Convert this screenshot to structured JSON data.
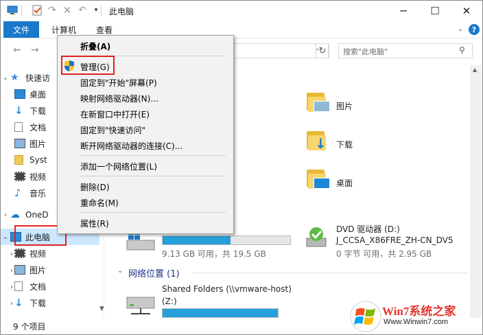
{
  "window": {
    "title": "此电脑",
    "controls": {
      "minimize": "─",
      "maximize": "☐",
      "close": "✕"
    }
  },
  "ribbon": {
    "file_tab": "文件",
    "tabs": [
      "计算机",
      "查看"
    ]
  },
  "search": {
    "placeholder": "搜索\"此电脑\""
  },
  "nav": {
    "quick_access": "快速访",
    "items": [
      {
        "label": "桌面"
      },
      {
        "label": "下载"
      },
      {
        "label": "文档"
      },
      {
        "label": "图片"
      },
      {
        "label": "Syst"
      },
      {
        "label": "视频"
      },
      {
        "label": "音乐"
      }
    ],
    "onedrive": "OneD",
    "this_pc": "此电脑",
    "pc_children": [
      {
        "label": "视频"
      },
      {
        "label": "图片"
      },
      {
        "label": "文档"
      },
      {
        "label": "下载"
      }
    ]
  },
  "content": {
    "folders": [
      {
        "label": "图片"
      },
      {
        "label": "下载"
      },
      {
        "label": "桌面"
      }
    ],
    "drive_c": {
      "free_text": "9.13 GB 可用，共 19.5 GB",
      "fill": 0.53
    },
    "dvd": {
      "name": "DVD 驱动器 (D:)",
      "volume": "J_CCSA_X86FRE_ZH-CN_DV5",
      "free_text": "0 字节 可用，共 2.95 GB"
    },
    "network_section": "网络位置 (1)",
    "share": {
      "name": "Shared Folders (\\\\vmware-host)",
      "drive": "(Z:)",
      "fill": 1.0
    }
  },
  "status": {
    "items": "9 个项目"
  },
  "context_menu": {
    "items": [
      {
        "label": "折叠(A)",
        "bold": true
      },
      {
        "label": "管理(G)"
      },
      {
        "label": "固定到\"开始\"屏幕(P)"
      },
      {
        "label": "映射网络驱动器(N)..."
      },
      {
        "label": "在新窗口中打开(E)"
      },
      {
        "label": "固定到\"快速访问\""
      },
      {
        "label": "断开网络驱动器的连接(C)..."
      },
      {
        "label": "添加一个网络位置(L)"
      },
      {
        "label": "删除(D)"
      },
      {
        "label": "重命名(M)"
      },
      {
        "label": "属性(R)"
      }
    ]
  },
  "watermark": {
    "brand": "Win7系统之家",
    "url": "Www.Winwin7.com"
  },
  "colors": {
    "accent": "#1979ca",
    "selection": "#cce8ff",
    "highlight_box": "#e02020",
    "progress": "#26a0da"
  }
}
